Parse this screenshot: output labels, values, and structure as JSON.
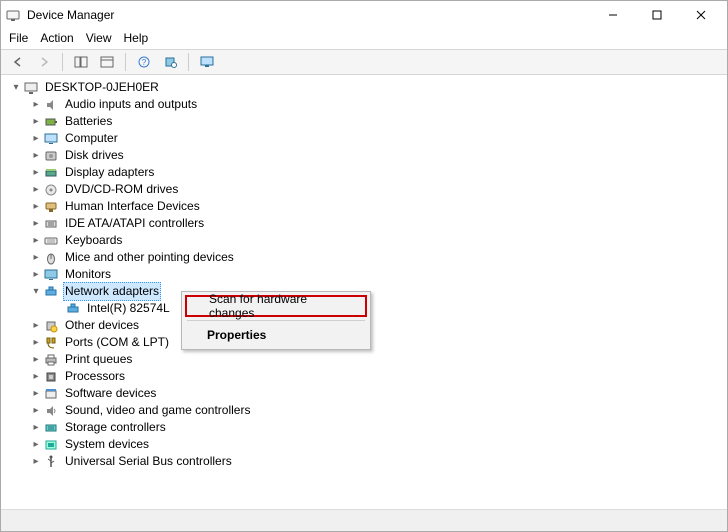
{
  "window": {
    "title": "Device Manager"
  },
  "menu": {
    "file": "File",
    "action": "Action",
    "view": "View",
    "help": "Help"
  },
  "root": {
    "name": "DESKTOP-0JEH0ER"
  },
  "categories": [
    {
      "label": "Audio inputs and outputs",
      "icon": "audio"
    },
    {
      "label": "Batteries",
      "icon": "battery"
    },
    {
      "label": "Computer",
      "icon": "computer"
    },
    {
      "label": "Disk drives",
      "icon": "disk"
    },
    {
      "label": "Display adapters",
      "icon": "display"
    },
    {
      "label": "DVD/CD-ROM drives",
      "icon": "optical"
    },
    {
      "label": "Human Interface Devices",
      "icon": "hid"
    },
    {
      "label": "IDE ATA/ATAPI controllers",
      "icon": "ide"
    },
    {
      "label": "Keyboards",
      "icon": "keyboard"
    },
    {
      "label": "Mice and other pointing devices",
      "icon": "mouse"
    },
    {
      "label": "Monitors",
      "icon": "monitor"
    },
    {
      "label": "Network adapters",
      "icon": "network",
      "expanded": true,
      "selected": true,
      "children": [
        {
          "label": "Intel(R) 82574L",
          "icon": "network"
        }
      ]
    },
    {
      "label": "Other devices",
      "icon": "other"
    },
    {
      "label": "Ports (COM & LPT)",
      "icon": "ports"
    },
    {
      "label": "Print queues",
      "icon": "printer"
    },
    {
      "label": "Processors",
      "icon": "cpu"
    },
    {
      "label": "Software devices",
      "icon": "software"
    },
    {
      "label": "Sound, video and game controllers",
      "icon": "sound"
    },
    {
      "label": "Storage controllers",
      "icon": "storage"
    },
    {
      "label": "System devices",
      "icon": "system"
    },
    {
      "label": "Universal Serial Bus controllers",
      "icon": "usb"
    }
  ],
  "context": {
    "scan": "Scan for hardware changes",
    "properties": "Properties"
  },
  "icons": {
    "right": "▸",
    "down": "▾"
  }
}
